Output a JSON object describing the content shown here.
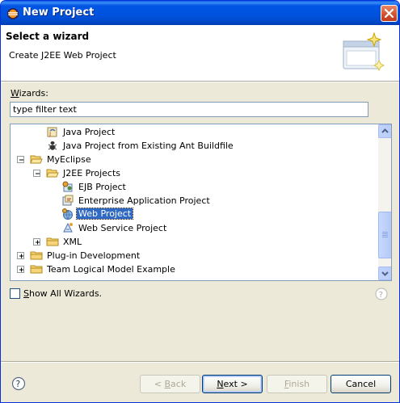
{
  "window": {
    "title": "New Project",
    "close_icon": "close-icon"
  },
  "banner": {
    "title": "Select a wizard",
    "description": "Create J2EE Web Project"
  },
  "wizards": {
    "label_prefix": "",
    "label_mnemonic": "W",
    "label_rest": "izards:",
    "filter_placeholder": "type filter text"
  },
  "tree": {
    "items": [
      {
        "label": "Java Project",
        "icon": "java-project-icon",
        "expander": "none",
        "selected": false
      },
      {
        "label": "Java Project from Existing Ant Buildfile",
        "icon": "ant-icon",
        "expander": "none",
        "selected": false
      },
      {
        "label": "MyEclipse",
        "icon": "folder-open-icon",
        "expander": "minus",
        "selected": false
      },
      {
        "label": "J2EE Projects",
        "icon": "folder-open-icon",
        "expander": "minus",
        "selected": false
      },
      {
        "label": "EJB Project",
        "icon": "ejb-project-icon",
        "expander": "none",
        "selected": false
      },
      {
        "label": "Enterprise Application Project",
        "icon": "enterprise-app-icon",
        "expander": "none",
        "selected": false
      },
      {
        "label": "Web Project",
        "icon": "web-project-icon",
        "expander": "none",
        "selected": true
      },
      {
        "label": "Web Service Project",
        "icon": "web-service-icon",
        "expander": "none",
        "selected": false
      },
      {
        "label": "XML",
        "icon": "folder-icon",
        "expander": "plus",
        "selected": false
      },
      {
        "label": "Plug-in Development",
        "icon": "folder-icon",
        "expander": "plus",
        "selected": false
      },
      {
        "label": "Team Logical Model Example",
        "icon": "folder-icon",
        "expander": "plus",
        "selected": false
      }
    ]
  },
  "show_all": {
    "label_mnemonic": "S",
    "label_rest": "how All Wizards.",
    "checked": false
  },
  "buttons": {
    "back_prefix": "< ",
    "back_mnemonic": "B",
    "back_rest": "ack",
    "next_mnemonic": "N",
    "next_rest": "ext >",
    "finish_mnemonic": "F",
    "finish_rest": "inish",
    "cancel": "Cancel"
  },
  "colors": {
    "titlebar": "#0055e5",
    "selection": "#316ac5",
    "dialog_bg": "#ece9d8"
  }
}
